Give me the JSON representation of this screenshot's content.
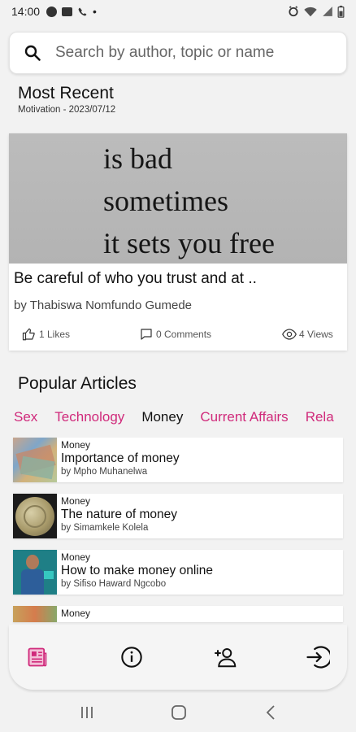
{
  "status_bar": {
    "time": "14:00"
  },
  "search": {
    "placeholder": "Search by author, topic or name"
  },
  "most_recent": {
    "heading": "Most Recent",
    "meta": "Motivation - 2023/07/12",
    "image_lines": [
      "is bad",
      "sometimes",
      "it sets you free"
    ],
    "title": "Be careful of who you trust and at ..",
    "author": "by Thabiswa Nomfundo Gumede",
    "likes": "1 Likes",
    "comments": "0 Comments",
    "views": "4 Views"
  },
  "popular": {
    "heading": "Popular Articles",
    "categories": [
      "Sex",
      "Technology",
      "Money",
      "Current Affairs",
      "Rela"
    ],
    "active_category": "Money",
    "articles": [
      {
        "category": "Money",
        "title": "Importance of money",
        "author": "by Mpho Muhanelwa"
      },
      {
        "category": "Money",
        "title": "The nature of money",
        "author": "by Simamkele Kolela"
      },
      {
        "category": "Money",
        "title": "How to make money online",
        "author": "by Sifiso Haward Ngcobo"
      },
      {
        "category": "Money",
        "title": "",
        "author": ""
      }
    ]
  },
  "colors": {
    "accent": "#d02a7b",
    "background": "#f2f2f2"
  },
  "bottom_nav": {
    "items": [
      "articles-icon",
      "info-icon",
      "add-user-icon",
      "logout-icon"
    ],
    "active": "articles-icon"
  }
}
